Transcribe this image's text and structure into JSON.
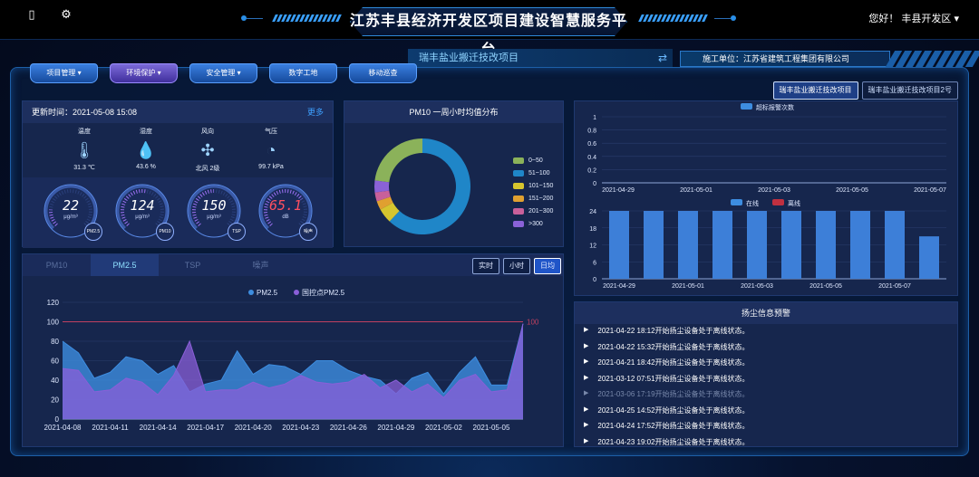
{
  "header": {
    "title": "江苏丰县经济开发区项目建设智慧服务平台",
    "greeting": "您好！ 丰县开发区",
    "icons": [
      "mobile-icon",
      "gear-icon"
    ]
  },
  "project_tab": {
    "label": "瑞丰盐业搬迁技改项目",
    "swap_icon": "⇄"
  },
  "contractor": "施工单位：江苏省建筑工程集团有限公司",
  "nav": [
    {
      "label": "项目管理 ▾"
    },
    {
      "label": "环境保护 ▾",
      "active": true
    },
    {
      "label": "安全管理 ▾"
    },
    {
      "label": "数字工地"
    },
    {
      "label": "移动巡查"
    }
  ],
  "project_buttons": [
    {
      "label": "瑞丰盐业搬迁技改项目",
      "active": true
    },
    {
      "label": "瑞丰盐业搬迁技改项目2号",
      "active": false
    }
  ],
  "environment": {
    "update_time": "更新时间：2021-05-08 15:08",
    "more": "更多",
    "items": [
      {
        "label": "温度",
        "value": "31.3 ℃",
        "icon": "thermometer-icon"
      },
      {
        "label": "湿度",
        "value": "43.6 %",
        "icon": "droplet-icon"
      },
      {
        "label": "风向",
        "value": "北风 2级",
        "icon": "fan-icon"
      },
      {
        "label": "气压",
        "value": "99.7 kPa",
        "icon": "gauge-icon"
      }
    ],
    "gauges": [
      {
        "value": "22",
        "unit": "μg/m³",
        "tag": "PM2.5",
        "level": 0.18
      },
      {
        "value": "124",
        "unit": "μg/m³",
        "tag": "PM10",
        "level": 0.55
      },
      {
        "value": "150",
        "unit": "μg/m³",
        "tag": "TSP",
        "level": 0.5
      },
      {
        "value": "65.1",
        "unit": "dB",
        "tag": "噪声",
        "level": 0.7
      }
    ]
  },
  "donut": {
    "title": "PM10 一周小时均值分布",
    "legend": [
      "0~50",
      "51~100",
      "101~150",
      "151~200",
      "201~300",
      ">300"
    ],
    "colors": [
      "#8bb25a",
      "#1f86c8",
      "#d6c52e",
      "#e0a030",
      "#c8609a",
      "#8a62d8"
    ]
  },
  "line_panel": {
    "tabs": [
      {
        "label": "PM10",
        "active": false
      },
      {
        "label": "PM2.5",
        "active": true
      },
      {
        "label": "TSP",
        "active": false
      },
      {
        "label": "噪声",
        "active": false
      }
    ],
    "modes": [
      {
        "label": "实时",
        "active": false
      },
      {
        "label": "小时",
        "active": false
      },
      {
        "label": "日均",
        "active": true
      }
    ]
  },
  "alerts": {
    "title": "扬尘信息预警",
    "items": [
      {
        "text": "2021-04-22 18:12开始扬尘设备处于离线状态。",
        "dim": false
      },
      {
        "text": "2021-04-22 15:32开始扬尘设备处于离线状态。",
        "dim": false
      },
      {
        "text": "2021-04-21 18:42开始扬尘设备处于离线状态。",
        "dim": false
      },
      {
        "text": "2021-03-12 07:51开始扬尘设备处于离线状态。",
        "dim": false
      },
      {
        "text": "2021-03-06 17:19开始扬尘设备处于离线状态。",
        "dim": true
      },
      {
        "text": "2021-04-25 14:52开始扬尘设备处于离线状态。",
        "dim": false
      },
      {
        "text": "2021-04-24 17:52开始扬尘设备处于离线状态。",
        "dim": false
      },
      {
        "text": "2021-04-23 19:02开始扬尘设备处于离线状态。",
        "dim": false
      }
    ]
  },
  "chart_data": [
    {
      "type": "pie",
      "title": "PM10 一周小时均值分布",
      "categories": [
        "0~50",
        "51~100",
        "101~150",
        "151~200",
        "201~300",
        ">300"
      ],
      "values": [
        23,
        62,
        5,
        3,
        3,
        4
      ]
    },
    {
      "type": "line",
      "x": [
        "2021-04-08",
        "2021-04-09",
        "2021-04-10",
        "2021-04-11",
        "2021-04-12",
        "2021-04-13",
        "2021-04-14",
        "2021-04-15",
        "2021-04-16",
        "2021-04-17",
        "2021-04-18",
        "2021-04-19",
        "2021-04-20",
        "2021-04-21",
        "2021-04-22",
        "2021-04-23",
        "2021-04-24",
        "2021-04-25",
        "2021-04-26",
        "2021-04-27",
        "2021-04-28",
        "2021-04-29",
        "2021-04-30",
        "2021-05-01",
        "2021-05-02",
        "2021-05-03",
        "2021-05-04",
        "2021-05-05",
        "2021-05-06",
        "2021-05-07"
      ],
      "xticks": [
        "2021-04-08",
        "2021-04-11",
        "2021-04-14",
        "2021-04-17",
        "2021-04-20",
        "2021-04-23",
        "2021-04-26",
        "2021-04-29",
        "2021-05-02",
        "2021-05-05"
      ],
      "series": [
        {
          "name": "PM2.5",
          "color": "#3d8de0",
          "values": [
            80,
            68,
            42,
            48,
            64,
            60,
            46,
            55,
            28,
            36,
            40,
            70,
            46,
            56,
            54,
            46,
            60,
            60,
            50,
            44,
            40,
            26,
            42,
            48,
            26,
            48,
            64,
            35,
            35,
            98
          ]
        },
        {
          "name": "国控点PM2.5",
          "color": "#8a5fd8",
          "values": [
            52,
            50,
            28,
            30,
            42,
            38,
            25,
            45,
            80,
            28,
            30,
            30,
            38,
            32,
            36,
            45,
            38,
            36,
            38,
            46,
            32,
            40,
            28,
            36,
            22,
            40,
            46,
            28,
            30,
            98
          ]
        }
      ],
      "threshold": {
        "value": 100,
        "label": "100",
        "color": "#c04060"
      },
      "ylim": [
        0,
        120
      ],
      "yticks": [
        0,
        20,
        40,
        60,
        80,
        100,
        120
      ]
    },
    {
      "type": "bar",
      "legend": [
        {
          "name": "超标报警次数",
          "color": "#3d8de0"
        }
      ],
      "categories": [
        "2021-04-29",
        "2021-05-01",
        "2021-05-03",
        "2021-05-05",
        "2021-05-07"
      ],
      "values": [],
      "yticks": [
        0,
        0.2,
        0.4,
        0.6,
        0.8,
        1
      ],
      "ylim": [
        0,
        1
      ]
    },
    {
      "type": "bar",
      "legend": [
        {
          "name": "在线",
          "color": "#3d8de0"
        },
        {
          "name": "离线",
          "color": "#c03040"
        }
      ],
      "categories": [
        "2021-04-29",
        "2021-04-30",
        "2021-05-01",
        "2021-05-02",
        "2021-05-03",
        "2021-05-04",
        "2021-05-05",
        "2021-05-06",
        "2021-05-07",
        "2021-05-08"
      ],
      "xticks": [
        "2021-04-29",
        "2021-05-01",
        "2021-05-03",
        "2021-05-05",
        "2021-05-07"
      ],
      "series": [
        {
          "name": "在线",
          "values": [
            24,
            24,
            24,
            24,
            24,
            24,
            24,
            24,
            24,
            15
          ]
        },
        {
          "name": "离线",
          "values": [
            0,
            0,
            0,
            0,
            0,
            0,
            0,
            0,
            0,
            0
          ]
        }
      ],
      "yticks": [
        0,
        6,
        12,
        18,
        24
      ],
      "ylim": [
        0,
        24
      ]
    }
  ]
}
